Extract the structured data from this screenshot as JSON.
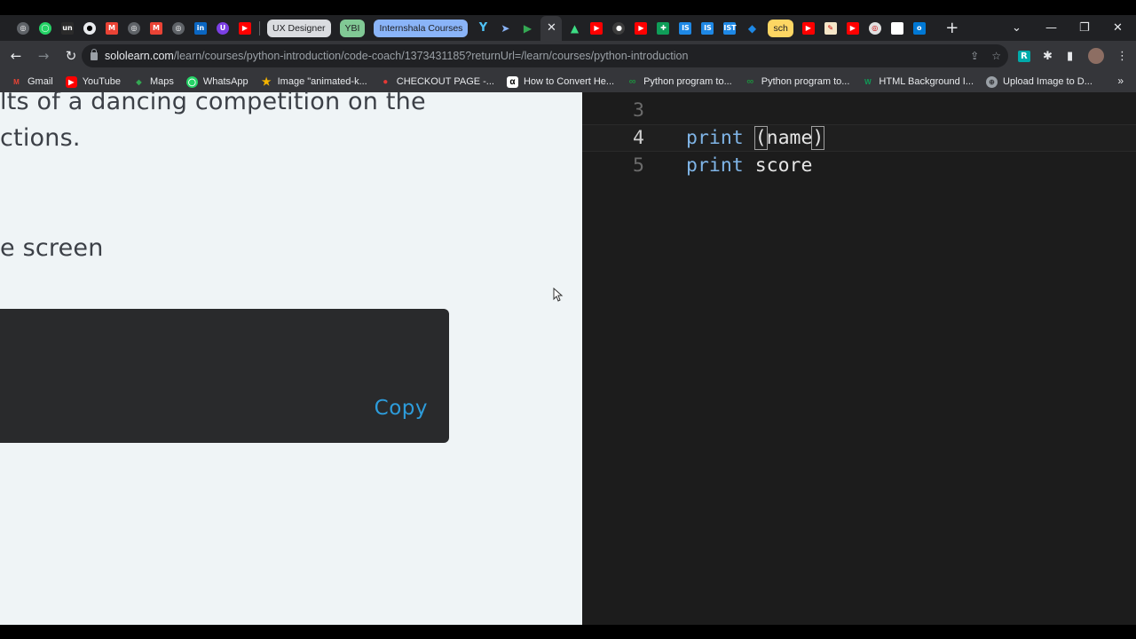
{
  "tabs": {
    "groups": [
      "UX Designer",
      "YBI",
      "Internshala Courses",
      "sch"
    ],
    "active_close": "✕",
    "new_tab": "+"
  },
  "window": {
    "minimize": "—",
    "restore": "❐",
    "close": "✕",
    "list": "⌄"
  },
  "address_bar": {
    "host": "sololearn.com",
    "path": "/learn/courses/python-introduction/code-coach/1373431185?returnUrl=/learn/courses/python-introduction"
  },
  "bookmarks": [
    {
      "label": "Gmail",
      "color": "#ea4335",
      "glyph": "M"
    },
    {
      "label": "YouTube",
      "color": "#ff0000",
      "glyph": "▶"
    },
    {
      "label": "Maps",
      "color": "#34a853",
      "glyph": "◆"
    },
    {
      "label": "WhatsApp",
      "color": "#25d366",
      "glyph": "◯"
    },
    {
      "label": "Image \"animated-k...",
      "color": "#f4b400",
      "glyph": "★"
    },
    {
      "label": "CHECKOUT PAGE -...",
      "color": "#e53935",
      "glyph": "●"
    },
    {
      "label": "How to Convert He...",
      "color": "#ffffff",
      "glyph": "α"
    },
    {
      "label": "Python program to...",
      "color": "#1e8e3e",
      "glyph": "∞"
    },
    {
      "label": "Python program to...",
      "color": "#1e8e3e",
      "glyph": "∞"
    },
    {
      "label": "HTML Background I...",
      "color": "#0f9d58",
      "glyph": "W"
    },
    {
      "label": "Upload Image to D...",
      "color": "#9aa0a6",
      "glyph": "⊕"
    }
  ],
  "bookmarks_more": "»",
  "description": {
    "line1": "lts of a dancing competition on the",
    "line2": "ctions.",
    "line3": "e screen"
  },
  "code_box": {
    "copy_label": "Copy"
  },
  "editor": {
    "lines": [
      {
        "num": "3",
        "keyword": "",
        "rest": ""
      },
      {
        "num": "4",
        "keyword": "print",
        "rest": "name"
      },
      {
        "num": "5",
        "keyword": "print",
        "rest": "score"
      }
    ]
  }
}
